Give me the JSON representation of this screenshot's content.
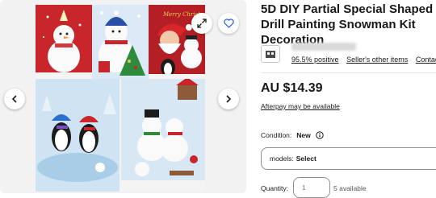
{
  "product": {
    "title": "5D DIY Partial Special Shaped Drill Painting Snowman Kit Decoration"
  },
  "gallery": {
    "panel_caption": "Merry Christmas",
    "icons": [
      "chevron-left-icon",
      "chevron-right-icon",
      "expand-icon",
      "heart-icon"
    ]
  },
  "seller": {
    "feedback": "95.5% positive",
    "other_items": "Seller's other items",
    "contact": "Contact s"
  },
  "price": "AU $14.39",
  "afterpay": "Afterpay may be available",
  "condition": {
    "label": "Condition:",
    "value": "New"
  },
  "variation": {
    "label": "models:",
    "value": "Select"
  },
  "quantity": {
    "label": "Quantity:",
    "value": "1",
    "available": "5 available"
  },
  "colors": {
    "accent": "#3665f3",
    "text": "#191919",
    "border": "#8f8f8f",
    "gallery_bg": "#f2f2f2"
  }
}
